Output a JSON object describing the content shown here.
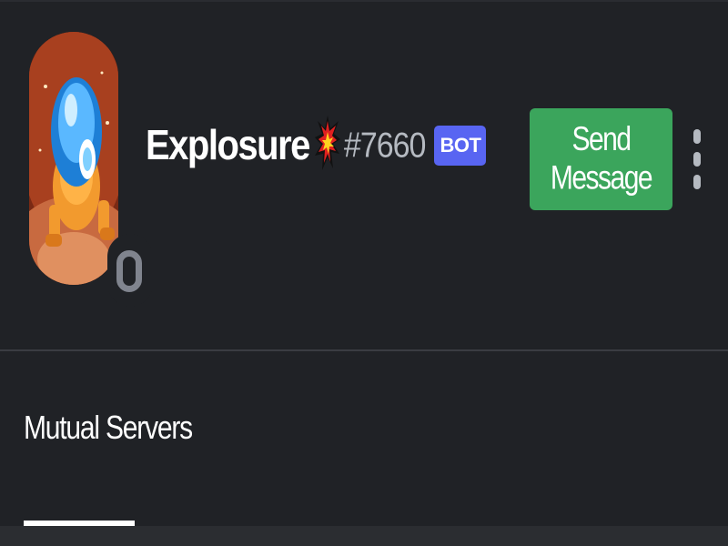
{
  "user": {
    "username": "Explosure",
    "discriminator": "#7660",
    "badge": "BOT",
    "status": "offline",
    "name_icon": "explosion-icon"
  },
  "actions": {
    "send_message_label": "Send Message",
    "more_icon": "more-vertical-icon"
  },
  "tabs": [
    {
      "label": "Mutual Servers",
      "active": true
    }
  ],
  "colors": {
    "background": "#202226",
    "send_button": "#3ba55c",
    "bot_badge": "#5865f2",
    "status_offline": "#80848e",
    "discriminator": "#b5bac1"
  }
}
